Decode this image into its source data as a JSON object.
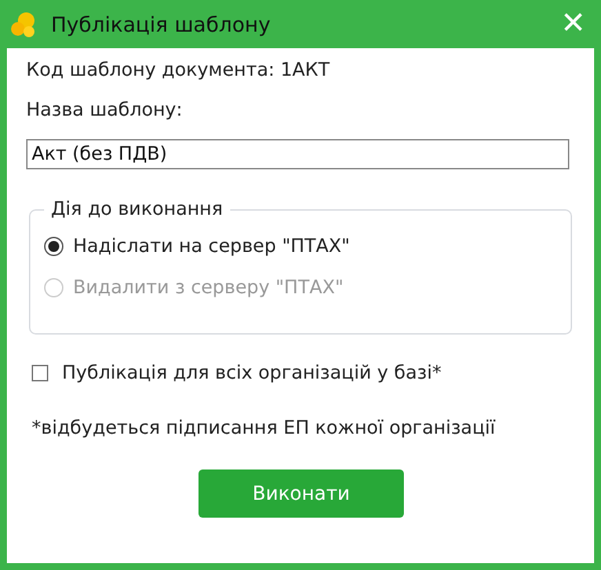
{
  "window": {
    "title": "Публікація шаблону",
    "close": "✕"
  },
  "code_line": "Код шаблону документа: 1АКТ",
  "name_label": "Назва шаблону:",
  "name_field": {
    "value": "Акт (без ПДВ)"
  },
  "action_group": {
    "legend": "Дія до виконання",
    "options": [
      {
        "label": "Надіслати на сервер \"ПТАХ\"",
        "selected": true,
        "disabled": false
      },
      {
        "label": "Видалити з серверу \"ПТАХ\"",
        "selected": false,
        "disabled": true
      }
    ]
  },
  "all_orgs": {
    "label": "Публікація для всіх організацій у базі*",
    "checked": false
  },
  "note": "*відбудеться підписання ЕП кожної організації",
  "buttons": [
    "Виконати"
  ]
}
